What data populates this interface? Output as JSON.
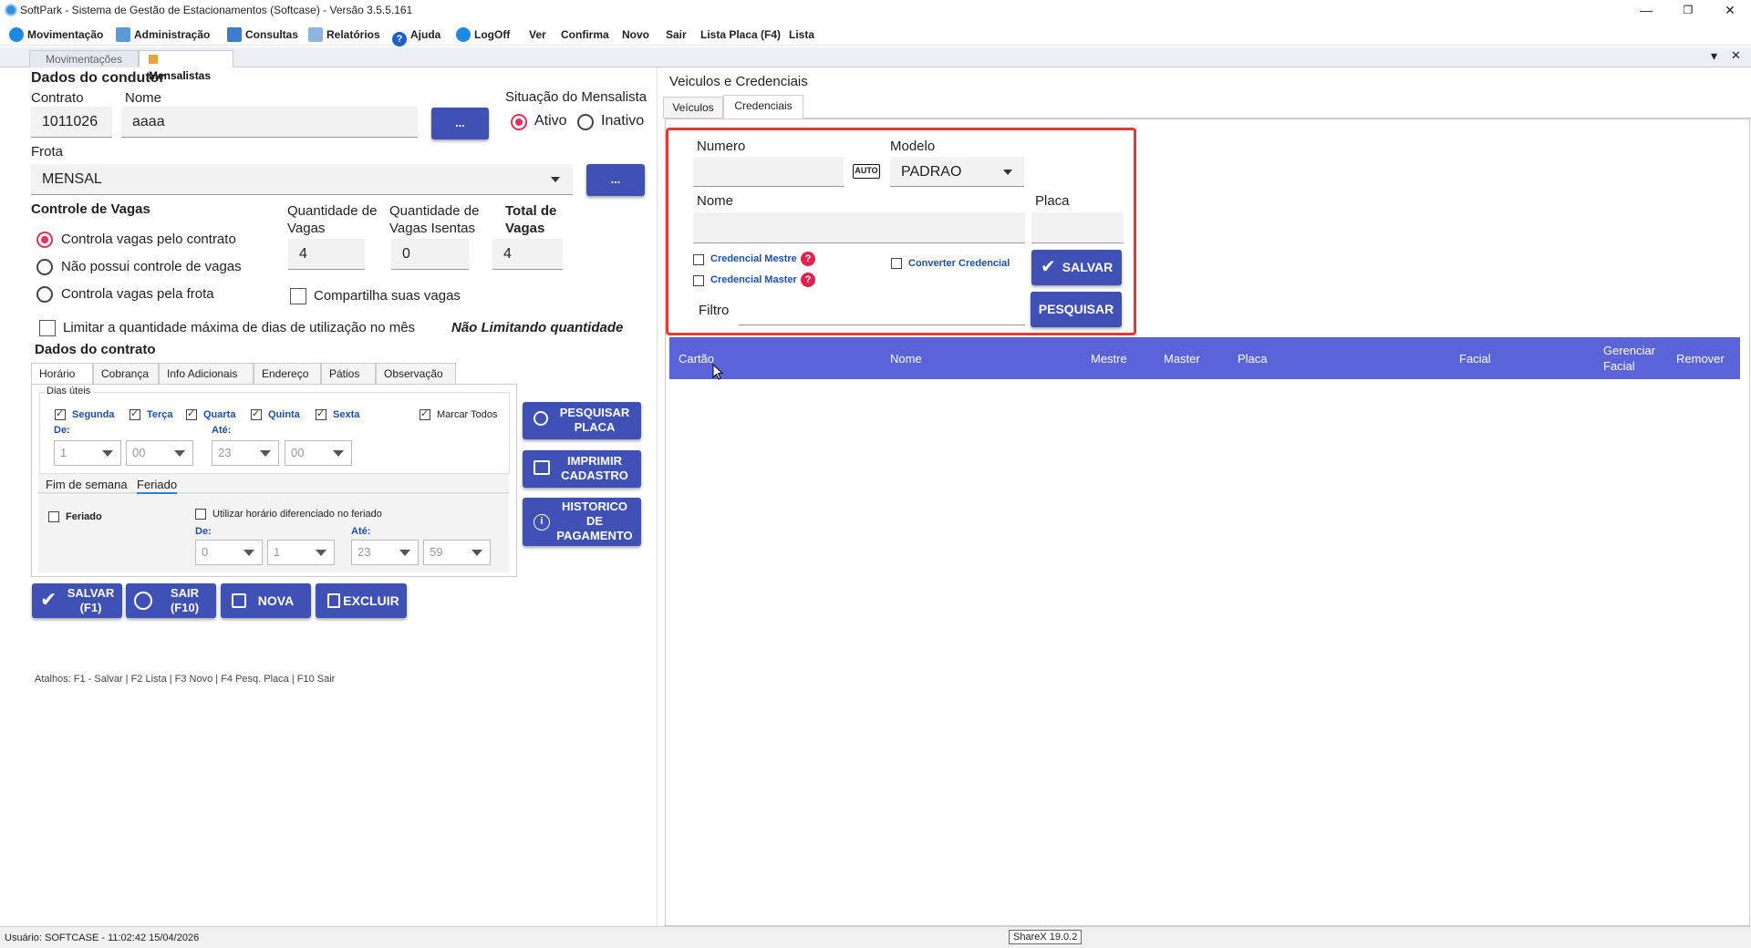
{
  "window": {
    "title": "SoftPark - Sistema de Gestão de Estacionamentos (Softcase) - Versão 3.5.5.161",
    "min": "—",
    "max": "❐",
    "close": "✕"
  },
  "menu": {
    "items": [
      "Movimentação",
      "Administração",
      "Consultas",
      "Relatórios",
      "Ajuda",
      "LogOff",
      "Ver",
      "Confirma",
      "Novo",
      "Sair",
      "Lista Placa (F4)",
      "Lista"
    ]
  },
  "doc_tabs": [
    "Movimentações",
    "Mensalistas"
  ],
  "doc_controls": {
    "chevron": "▾",
    "close": "✕"
  },
  "condutor": {
    "section_title": "Dados do condutor",
    "contrato_label": "Contrato",
    "contrato_value": "1011026",
    "nome_label": "Nome",
    "nome_value": "aaaa",
    "ellipsis": "...",
    "situacao_label": "Situação do Mensalista",
    "ativo": "Ativo",
    "inativo": "Inativo",
    "frota_label": "Frota",
    "frota_value": "MENSAL"
  },
  "vagas": {
    "title": "Controle de Vagas",
    "opt1": "Controla vagas pelo contrato",
    "opt2": "Não possui controle de vagas",
    "opt3": "Controla vagas pela frota",
    "qtd_label": "Quantidade de Vagas",
    "qtd_value": "4",
    "isentas_label": "Quantidade de Vagas Isentas",
    "isentas_value": "0",
    "total_label": "Total de Vagas",
    "total_value": "4",
    "compartilha": "Compartilha suas vagas",
    "limitar": "Limitar a quantidade máxima de dias de utilização no mês",
    "limitar_status": "Não Limitando quantidade"
  },
  "contrato": {
    "title": "Dados do contrato",
    "tabs": [
      "Horário",
      "Cobrança",
      "Info Adicionais",
      "Endereço",
      "Pátios",
      "Observação"
    ],
    "dias_uteis": "Dias úteis",
    "days": [
      "Segunda",
      "Terça",
      "Quarta",
      "Quinta",
      "Sexta"
    ],
    "marcar_todos": "Marcar Todos",
    "de": "De:",
    "ate": "Até:",
    "de_h": "1",
    "de_m": "00",
    "ate_h": "23",
    "ate_m": "00",
    "subtabs": [
      "Fim de semana",
      "Feriado"
    ],
    "feriado": "Feriado",
    "utilizar": "Utilizar horário diferenciado no feriado",
    "f_de_h": "0",
    "f_de_m": "1",
    "f_ate_h": "23",
    "f_ate_m": "59"
  },
  "side_buttons": {
    "pesquisar_placa": [
      "PESQUISAR",
      "PLACA"
    ],
    "imprimir": [
      "IMPRIMIR",
      "CADASTRO"
    ],
    "historico": [
      "HISTORICO",
      "DE",
      "PAGAMENTO"
    ]
  },
  "bottom_buttons": {
    "salvar": [
      "SALVAR",
      "(F1)"
    ],
    "sair": [
      "SAIR",
      "(F10)"
    ],
    "nova": "NOVA",
    "excluir": "EXCLUIR"
  },
  "atalhos": "Atalhos: F1 - Salvar | F2 Lista | F3 Novo | F4 Pesq. Placa | F10 Sair",
  "veiculos": {
    "title": "Veiculos e Credenciais",
    "tabs": [
      "Veículos",
      "Credenciais"
    ]
  },
  "credencial": {
    "numero_label": "Numero",
    "numero_value": "",
    "auto": "AUTO",
    "modelo_label": "Modelo",
    "modelo_value": "PADRAO",
    "nome_label": "Nome",
    "placa_label": "Placa",
    "mestre": "Credencial Mestre",
    "master": "Credencial Master",
    "converter": "Converter Credencial",
    "salvar": "SALVAR",
    "filtro_label": "Filtro",
    "pesquisar": "PESQUISAR",
    "help": "?"
  },
  "grid": {
    "columns": [
      "Cartão",
      "Nome",
      "Mestre",
      "Master",
      "Placa",
      "Facial",
      "Gerenciar Facial",
      "Remover"
    ]
  },
  "status": {
    "usuario": "Usuário:  SOFTCASE - 11:02:42 15/04/2026",
    "sharex": "ShareX 19.0.2"
  },
  "colors": {
    "accent": "#3f51b5",
    "grid_header": "#5a63d8",
    "highlight": "#e53935",
    "radio": "#e3315b"
  }
}
